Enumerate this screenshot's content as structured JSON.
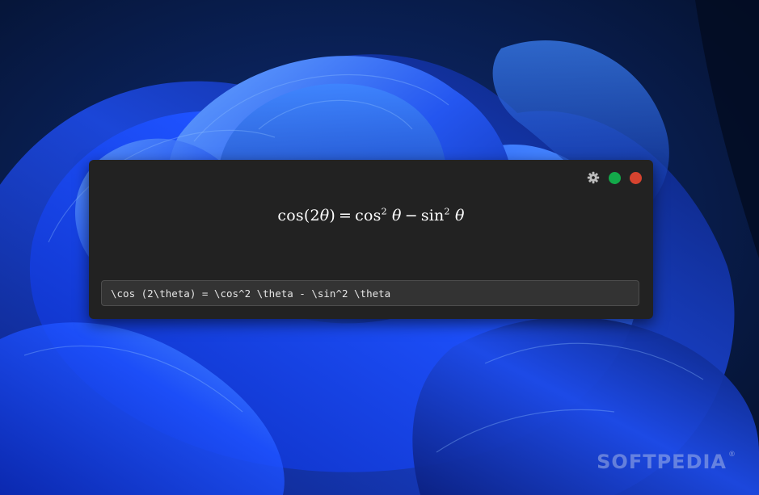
{
  "desktop": {
    "watermark": "SOFTPEDIA",
    "watermark_mark": "®",
    "colors": {
      "deep": "#061536",
      "bloom": "#1a44e8",
      "highlight": "#3a7bff"
    }
  },
  "window": {
    "controls": {
      "settings_icon": "gear-icon",
      "maximize_color": "#13a94a",
      "close_color": "#d6432f"
    },
    "rendered_formula": {
      "lhs_func": "cos",
      "lhs_open": "(",
      "lhs_num": "2",
      "lhs_var": "θ",
      "lhs_close": ")",
      "equals": "=",
      "term1_func": "cos",
      "term1_exp": "2",
      "term1_var": "θ",
      "minus": "−",
      "term2_func": "sin",
      "term2_exp": "2",
      "term2_var": "θ"
    },
    "latex_input": {
      "value": "\\cos (2\\theta) = \\cos^2 \\theta - \\sin^2 \\theta"
    }
  }
}
